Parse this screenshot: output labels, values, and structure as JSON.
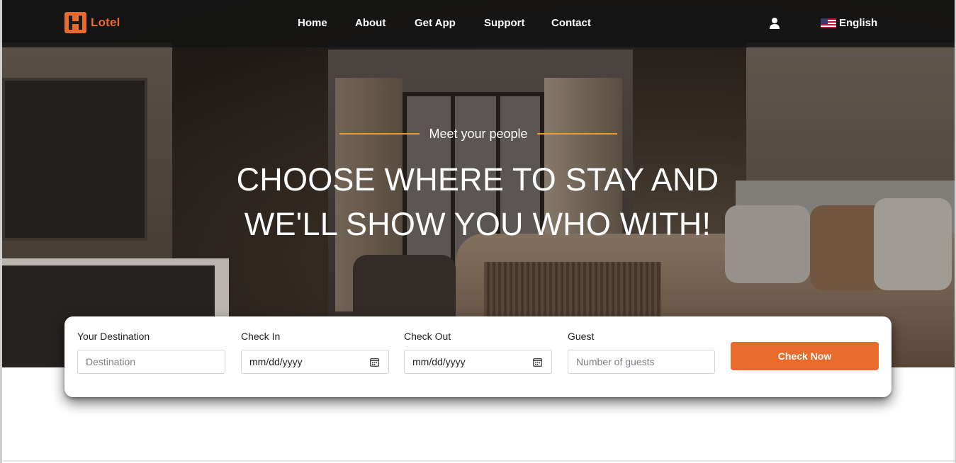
{
  "brand": {
    "name": "Lotel",
    "accent_color": "#e86a2d"
  },
  "nav": {
    "links": [
      "Home",
      "About",
      "Get App",
      "Support",
      "Contact"
    ],
    "user_icon": "user-icon",
    "language": {
      "flag": "us-flag-icon",
      "label": "English"
    }
  },
  "hero": {
    "tagline": "Meet your people",
    "tagline_line_color": "#e8a027",
    "headline_line1": "CHOOSE WHERE TO STAY AND",
    "headline_line2": "WE'LL SHOW YOU WHO WITH!"
  },
  "search": {
    "destination": {
      "label": "Your Destination",
      "placeholder": "Destination"
    },
    "check_in": {
      "label": "Check In",
      "value": "mm/dd/yyyy",
      "icon": "calendar-icon"
    },
    "check_out": {
      "label": "Check Out",
      "value": "mm/dd/yyyy",
      "icon": "calendar-icon"
    },
    "guest": {
      "label": "Guest",
      "placeholder": "Number of guests"
    },
    "button_label": "Check Now"
  }
}
